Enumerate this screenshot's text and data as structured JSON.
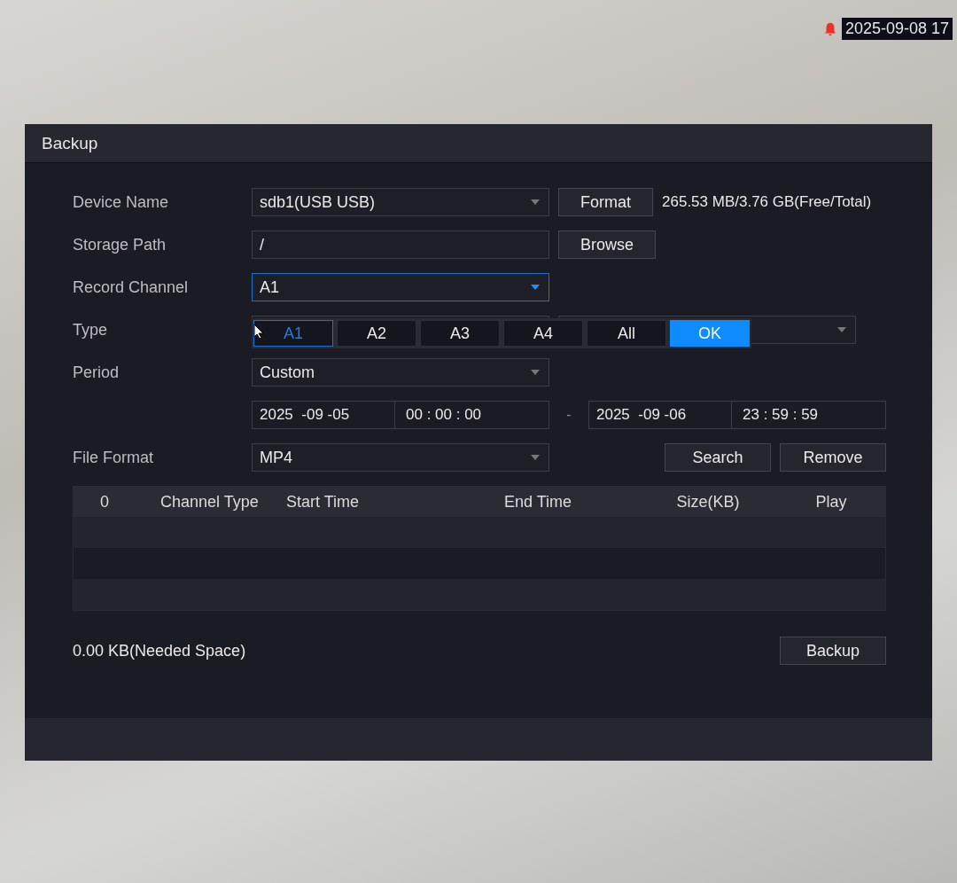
{
  "overlay": {
    "timestamp": "2025-09-08 17"
  },
  "window": {
    "title": "Backup"
  },
  "rows": [
    {
      "kind": "select",
      "label": "Device Name",
      "value": "sdb1(USB USB)",
      "focused": false,
      "button": "Format",
      "note": "265.53 MB/3.76 GB(Free/Total)"
    },
    {
      "kind": "input",
      "label": "Storage Path",
      "value": "/",
      "button": "Browse"
    },
    {
      "kind": "select",
      "label": "Record Channel",
      "value": "A1",
      "focused": true
    },
    {
      "kind": "pair",
      "label": "Type"
    },
    {
      "kind": "select",
      "label": "Period",
      "value": "Custom",
      "focused": false
    },
    {
      "kind": "range",
      "start_date": "2025  -09 -05",
      "start_time": "00 : 00 : 00",
      "separator": "-",
      "end_date": "2025  -09 -06",
      "end_time": "23 : 59 : 59"
    },
    {
      "kind": "select",
      "label": "File Format",
      "value": "MP4",
      "focused": false,
      "buttons": [
        "Search",
        "Remove"
      ]
    }
  ],
  "channel_popup": {
    "options": [
      {
        "label": "A1",
        "selected": true
      },
      {
        "label": "A2",
        "selected": false
      },
      {
        "label": "A3",
        "selected": false
      },
      {
        "label": "A4",
        "selected": false
      },
      {
        "label": "All",
        "selected": false
      }
    ],
    "confirm": "OK"
  },
  "table": {
    "columns": [
      "0",
      "Channel Type",
      "Start Time",
      "End Time",
      "Size(KB)",
      "Play"
    ]
  },
  "footer": {
    "needed_space": "0.00 KB(Needed Space)",
    "button": "Backup"
  }
}
